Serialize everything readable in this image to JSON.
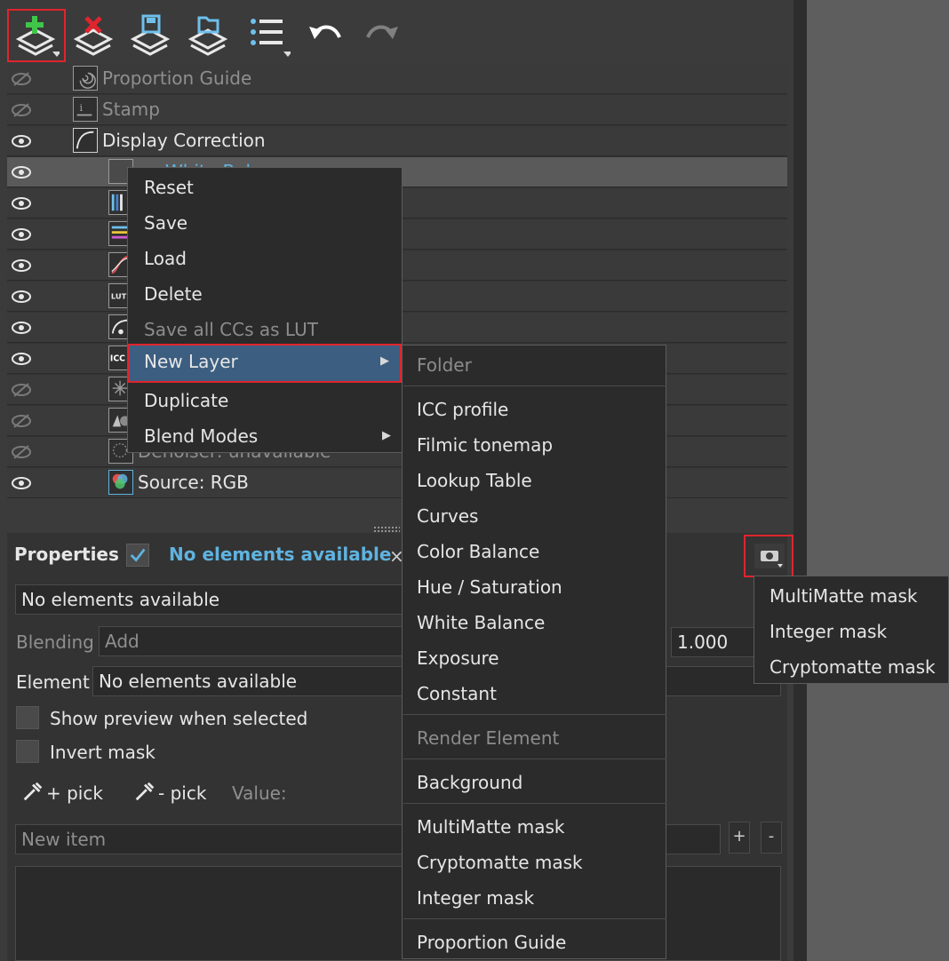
{
  "toolbar": {
    "buttons": [
      {
        "icon": "add-layer-icon"
      },
      {
        "icon": "delete-layer-icon"
      },
      {
        "icon": "save-layer-icon"
      },
      {
        "icon": "load-layer-icon"
      },
      {
        "icon": "layer-list-icon"
      },
      {
        "icon": "undo-icon"
      },
      {
        "icon": "redo-icon"
      }
    ]
  },
  "layers": [
    {
      "name": "Proportion Guide",
      "visible": false
    },
    {
      "name": "Stamp",
      "visible": false
    },
    {
      "name": "Display Correction",
      "visible": true
    },
    {
      "name": "White Bal...",
      "visible": true,
      "selected": true
    },
    {
      "name": "",
      "visible": true
    },
    {
      "name": "",
      "visible": true
    },
    {
      "name": "",
      "visible": true
    },
    {
      "name": "",
      "visible": true
    },
    {
      "name": "",
      "visible": true
    },
    {
      "name": "",
      "visible": true
    },
    {
      "name": "",
      "visible": false
    },
    {
      "name": "",
      "visible": false
    },
    {
      "name": "Denoiser: unavailable",
      "visible": false
    },
    {
      "name": "Source: RGB",
      "visible": true
    }
  ],
  "context_menu": {
    "items": [
      "Reset",
      "Save",
      "Load",
      "Delete",
      "Save all CCs as LUT",
      "New Layer",
      "Duplicate",
      "Blend Modes"
    ]
  },
  "new_layer_menu": {
    "items": [
      "Folder",
      "ICC profile",
      "Filmic tonemap",
      "Lookup Table",
      "Curves",
      "Color Balance",
      "Hue / Saturation",
      "White Balance",
      "Exposure",
      "Constant",
      "Render Element",
      "Background",
      "MultiMatte mask",
      "Cryptomatte mask",
      "Integer mask",
      "Proportion Guide"
    ]
  },
  "mask_menu": {
    "items": [
      "MultiMatte mask",
      "Integer mask",
      "Cryptomatte mask"
    ]
  },
  "properties": {
    "title": "Properties",
    "status": "No elements available",
    "close_glyph": "×",
    "element_select": "No elements available",
    "blending_label": "Blending",
    "blending_value": "Add",
    "opacity_value": "1.000",
    "element_label": "Element",
    "element_value": "No elements available",
    "show_preview_label": "Show preview when selected",
    "invert_mask_label": "Invert mask",
    "pick_plus_label": "+ pick",
    "pick_minus_label": "- pick",
    "value_label": "Value:",
    "new_item_placeholder": "New item",
    "add_glyph": "+",
    "remove_glyph": "-"
  },
  "colors": {
    "accent_blue": "#5fb3e0",
    "highlight_red": "#e0242d",
    "menu_selected": "#3c5e80"
  }
}
